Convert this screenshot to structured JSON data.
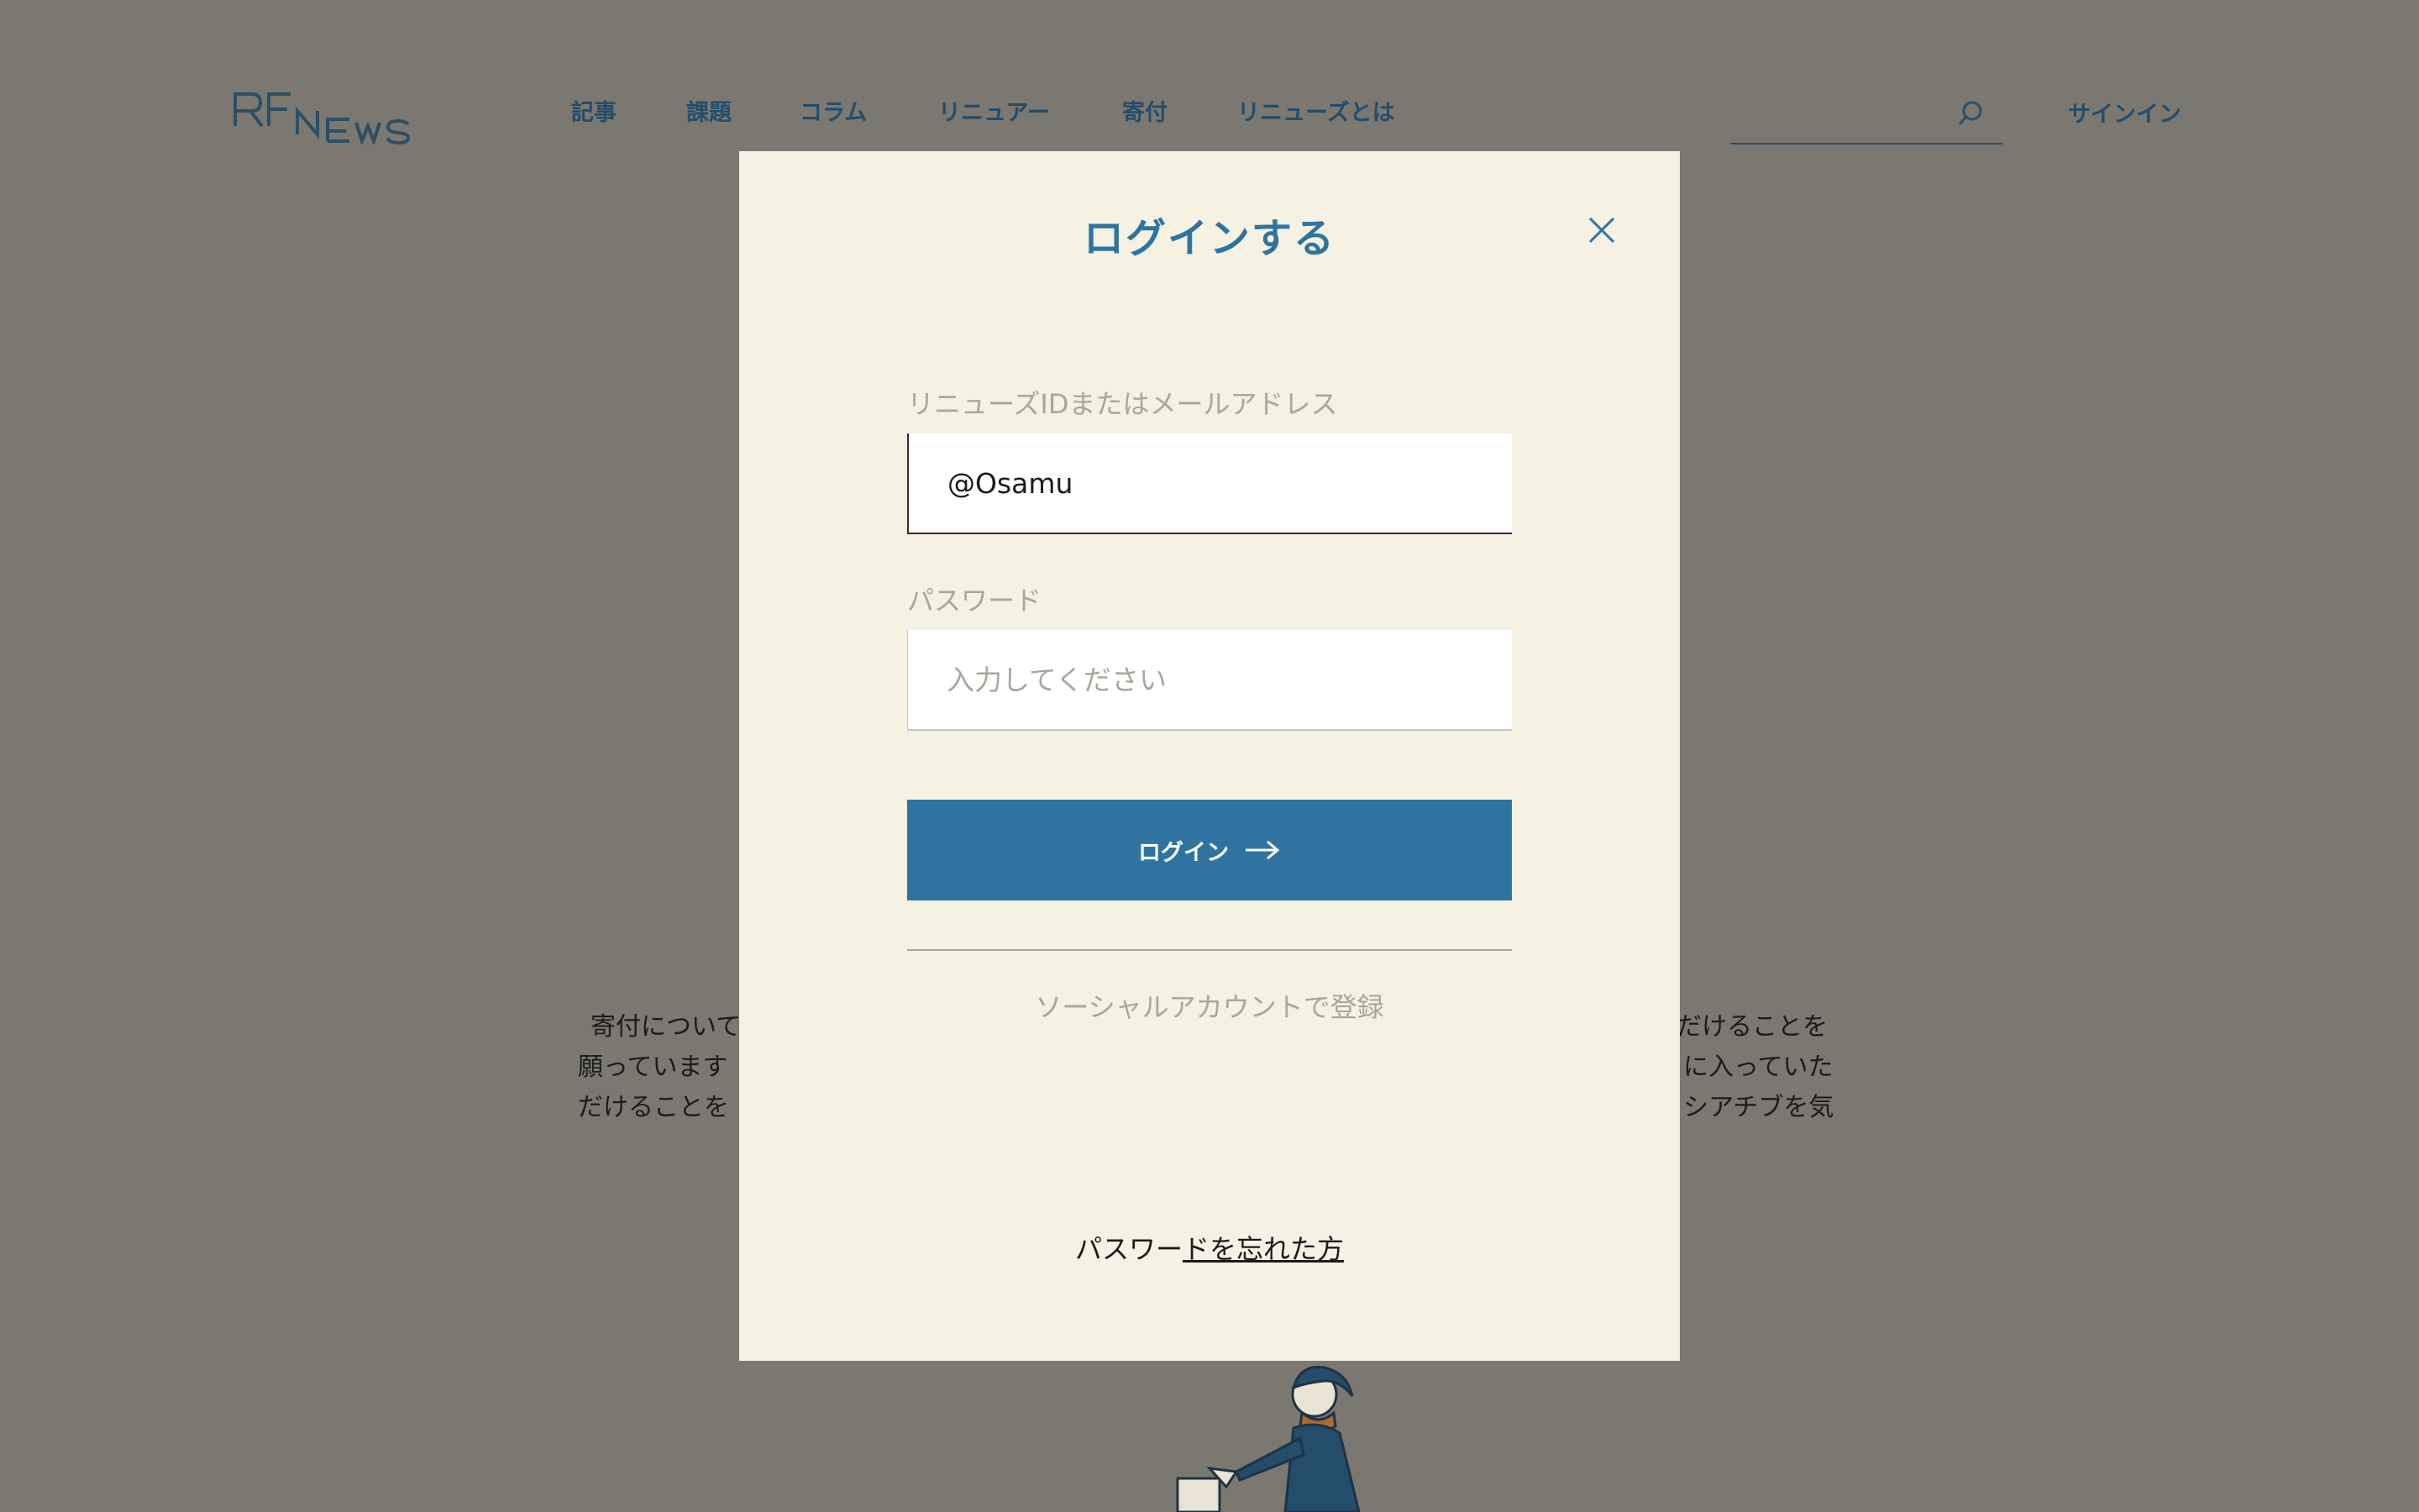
{
  "header": {
    "logo": "RENEWS",
    "nav": [
      {
        "label": "記事"
      },
      {
        "label": "課題"
      },
      {
        "label": "コラム"
      },
      {
        "label": "リニュアー"
      },
      {
        "label": "寄付"
      },
      {
        "label": "リニューズとは"
      }
    ],
    "search_value": "",
    "signin_label": "サインイン"
  },
  "background": {
    "text_left": [
      "寄付について",
      "願っています",
      "だけることを"
    ],
    "text_right": [
      "だけることを",
      "に入っていた",
      "シアチブを気"
    ]
  },
  "modal": {
    "title": "ログインする",
    "id_label": "リニューズIDまたはメールアドレス",
    "id_value": "@Osamu",
    "password_label": "パスワード",
    "password_placeholder": "入力してください",
    "login_button": "ログイン",
    "social_label": "ソーシャルアカウントで登録",
    "forgot_prefix": "パスワー",
    "forgot_link": "ドを忘れた方"
  },
  "colors": {
    "overlay": "#7b7871",
    "modal_bg": "#f5f1e3",
    "accent": "#2f74a1",
    "nav_text": "#234d6a",
    "muted": "#a9a69d"
  },
  "icons": [
    "search-icon",
    "close-icon",
    "arrow-right-icon"
  ]
}
